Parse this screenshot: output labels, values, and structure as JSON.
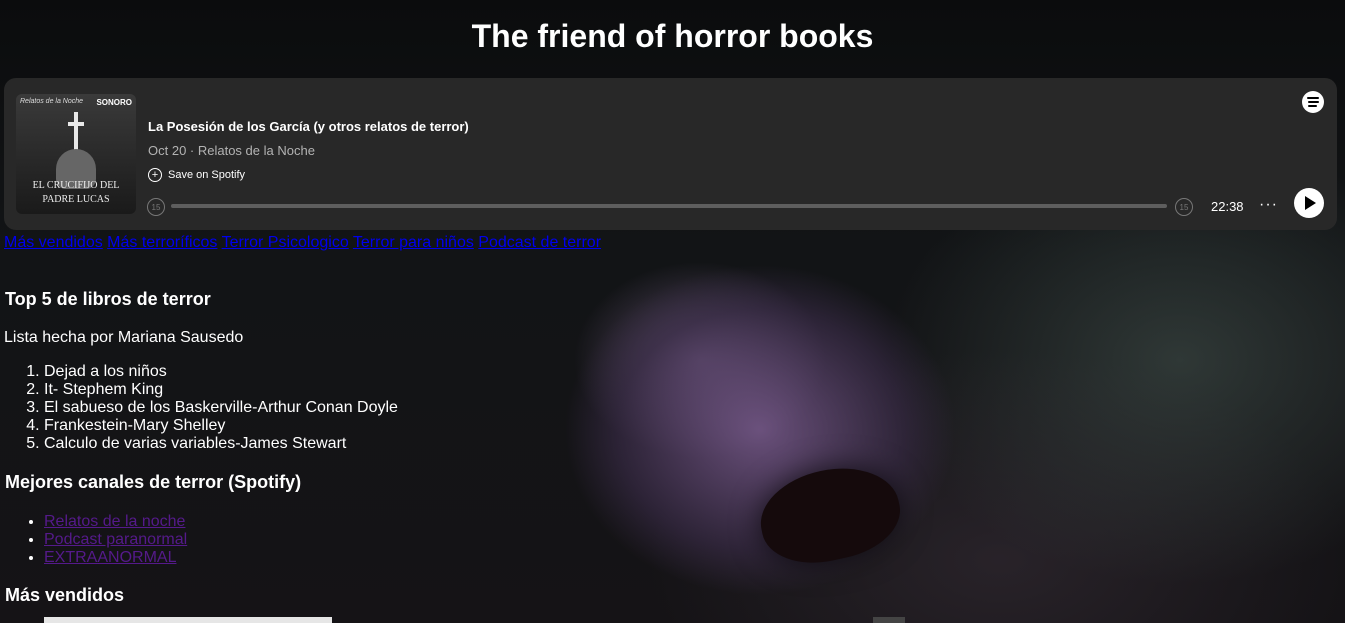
{
  "page": {
    "title": "The friend of horror books"
  },
  "spotify_embed": {
    "cover": {
      "brand_left": "Relatos de la Noche",
      "brand_right": "SONORO",
      "line1": "EL CRUCIFIJO DEL",
      "line2": "PADRE LUCAS"
    },
    "episode_title": "La Posesión de los García (y otros relatos de terror)",
    "meta": "Oct 20 · Relatos de la Noche",
    "save_label": "Save on Spotify",
    "skip_back": "15",
    "skip_forward": "15",
    "duration": "22:38",
    "more": "···",
    "progress": 0
  },
  "nav": {
    "links": [
      "Más vendidos",
      "Más terroríficos",
      "Terror Psicologico",
      "Terror para niños",
      "Podcast de terror"
    ]
  },
  "top5": {
    "heading": "Top 5 de libros de terror",
    "byline": "Lista hecha por Mariana Sausedo",
    "items": [
      "Dejad a los niños",
      "It- Stephem King",
      "El sabueso de los Baskerville-Arthur Conan Doyle",
      "Frankestein-Mary Shelley",
      "Calculo de varias variables-James Stewart"
    ]
  },
  "channels": {
    "heading": "Mejores canales de terror (Spotify)",
    "items": [
      "Relatos de la noche",
      "Podcast paranormal",
      "EXTRAANORMAL"
    ]
  },
  "best_sellers": {
    "heading": "Más vendidos"
  }
}
